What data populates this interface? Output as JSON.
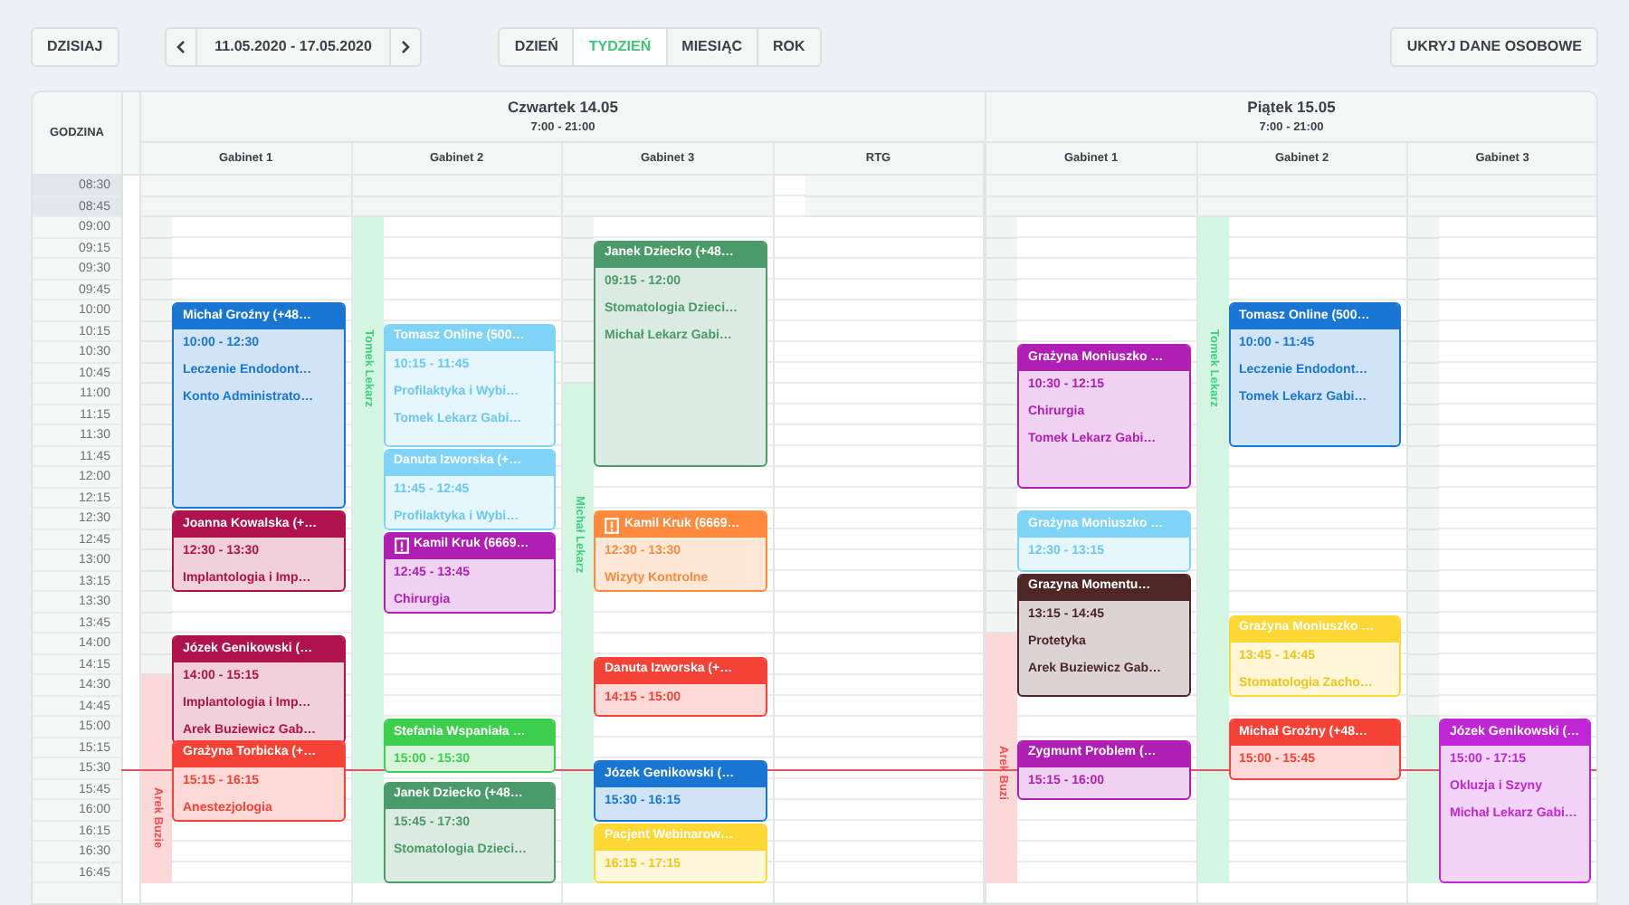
{
  "toolbar": {
    "today_button": "DZISIAJ",
    "date_range": "11.05.2020 - 17.05.2020",
    "views": [
      {
        "label": "DZIEŃ",
        "selected": false
      },
      {
        "label": "TYDZIEŃ",
        "selected": true
      },
      {
        "label": "MIESIĄC",
        "selected": false
      },
      {
        "label": "ROK",
        "selected": false
      }
    ],
    "hide_button": "UKRYJ DANE OSOBOWE"
  },
  "calendar": {
    "time_column_label": "GODZINA",
    "time_slots": [
      {
        "label": "08:30",
        "closed": true,
        "now": false
      },
      {
        "label": "08:45",
        "closed": true,
        "now": false
      },
      {
        "label": "09:00",
        "closed": false,
        "now": false
      },
      {
        "label": "09:15",
        "closed": false,
        "now": false
      },
      {
        "label": "09:30",
        "closed": false,
        "now": false
      },
      {
        "label": "09:45",
        "closed": false,
        "now": false
      },
      {
        "label": "10:00",
        "closed": false,
        "now": false
      },
      {
        "label": "10:15",
        "closed": false,
        "now": false
      },
      {
        "label": "10:30",
        "closed": false,
        "now": false
      },
      {
        "label": "10:45",
        "closed": false,
        "now": false
      },
      {
        "label": "11:00",
        "closed": false,
        "now": false
      },
      {
        "label": "11:15",
        "closed": false,
        "now": false
      },
      {
        "label": "11:30",
        "closed": false,
        "now": false
      },
      {
        "label": "11:45",
        "closed": false,
        "now": false
      },
      {
        "label": "12:00",
        "closed": false,
        "now": false
      },
      {
        "label": "12:15",
        "closed": false,
        "now": false
      },
      {
        "label": "12:30",
        "closed": false,
        "now": false
      },
      {
        "label": "12:45",
        "closed": false,
        "now": false
      },
      {
        "label": "13:00",
        "closed": false,
        "now": false
      },
      {
        "label": "13:15",
        "closed": false,
        "now": false
      },
      {
        "label": "13:30",
        "closed": false,
        "now": false
      },
      {
        "label": "13:45",
        "closed": false,
        "now": false
      },
      {
        "label": "14:00",
        "closed": false,
        "now": false
      },
      {
        "label": "14:15",
        "closed": false,
        "now": false
      },
      {
        "label": "14:30",
        "closed": false,
        "now": false
      },
      {
        "label": "14:45",
        "closed": false,
        "now": false
      },
      {
        "label": "15:00",
        "closed": false,
        "now": false
      },
      {
        "label": "15:15",
        "closed": false,
        "now": false
      },
      {
        "label": "15:30",
        "closed": false,
        "now": true
      },
      {
        "label": "15:45",
        "closed": false,
        "now": false
      },
      {
        "label": "16:00",
        "closed": false,
        "now": false
      },
      {
        "label": "16:15",
        "closed": false,
        "now": false
      },
      {
        "label": "16:30",
        "closed": false,
        "now": false
      },
      {
        "label": "16:45",
        "closed": false,
        "now": false
      }
    ],
    "days": [
      {
        "title": "Czwartek 14.05",
        "hours": "7:00 - 21:00",
        "rooms": [
          {
            "name": "Gabinet 1",
            "strip": {
              "doctor": "Arek Buzie",
              "color": "#fdd8d8",
              "on_shift": [
                false,
                false,
                false,
                false,
                false,
                false,
                false,
                false,
                false,
                false,
                false,
                false,
                false,
                false,
                false,
                false,
                false,
                false,
                false,
                false,
                false,
                false,
                false,
                false,
                true,
                true,
                true,
                true,
                true,
                true,
                true,
                true,
                true,
                true
              ]
            },
            "events": [
              {
                "patient": "Michał Groźny (+48…",
                "time": "10:00 - 12:30",
                "lines": [
                  "Leczenie Endodont…",
                  "Konto Administrato…"
                ],
                "color": "#1976d2",
                "alert": false
              },
              {
                "patient": "Joanna Kowalska (+…",
                "time": "12:30 - 13:30",
                "lines": [
                  "Implantologia i Imp…"
                ],
                "color": "#b0124a",
                "alert": false
              },
              {
                "patient": "Józek Genikowski (…",
                "time": "14:00 - 15:15",
                "lines": [
                  "Implantologia i Imp…",
                  "Arek Buziewicz Gab…"
                ],
                "color": "#b0124a",
                "alert": false
              },
              {
                "patient": "Grażyna Torbicka (+…",
                "time": "15:15 - 16:15",
                "lines": [
                  "Anestezjologia"
                ],
                "color": "#f44336",
                "alert": false
              }
            ]
          },
          {
            "name": "Gabinet 2",
            "strip": {
              "doctor": "Tomek Lekarz",
              "color": "#d5f5e3",
              "on_shift": [
                false,
                false,
                true,
                true,
                true,
                true,
                true,
                true,
                true,
                true,
                true,
                true,
                true,
                true,
                true,
                true,
                true,
                true,
                true,
                true,
                true,
                true,
                true,
                true,
                true,
                true,
                true,
                true,
                true,
                true,
                true,
                true,
                true,
                true
              ]
            },
            "events": [
              {
                "patient": "Tomasz Online (500…",
                "time": "10:15 - 11:45",
                "lines": [
                  "Profilaktyka i Wybi…",
                  "Tomek Lekarz Gabi…"
                ],
                "color": "#7fd3f7",
                "alert": false
              },
              {
                "patient": "Danuta Izworska (+…",
                "time": "11:45 - 12:45",
                "lines": [
                  "Profilaktyka i Wybi…"
                ],
                "color": "#7fd3f7",
                "alert": false
              },
              {
                "patient": "Kamil Kruk (6669…",
                "time": "12:45 - 13:45",
                "lines": [
                  "Chirurgia"
                ],
                "color": "#b01fb3",
                "alert": true
              },
              {
                "patient": "Stefania Wspaniała …",
                "time": "15:00 - 15:30",
                "color": "#3ccf4e",
                "alert": false
              },
              {
                "patient": "Janek Dziecko (+48…",
                "time": "15:45 - 17:30",
                "lines": [
                  "Stomatologia Dzieci…"
                ],
                "color": "#4a9a6a",
                "alert": false
              }
            ]
          },
          {
            "name": "Gabinet 3",
            "strip": {
              "doctor": "Michał Lekarz",
              "color": "#d5f5e3",
              "on_shift": [
                false,
                false,
                false,
                false,
                false,
                false,
                false,
                false,
                false,
                false,
                true,
                true,
                true,
                true,
                true,
                true,
                true,
                true,
                true,
                true,
                true,
                true,
                true,
                true,
                true,
                true,
                true,
                true,
                true,
                true,
                true,
                true,
                true,
                true
              ]
            },
            "events": [
              {
                "patient": "Janek Dziecko (+48…",
                "time": "09:15 - 12:00",
                "lines": [
                  "Stomatologia Dzieci…",
                  "Michał Lekarz Gabi…"
                ],
                "color": "#4a9a6a",
                "alert": false
              },
              {
                "patient": "Kamil Kruk (6669…",
                "time": "12:30 - 13:30",
                "lines": [
                  "Wizyty Kontrolne"
                ],
                "color": "#ff8a3d",
                "alert": true
              },
              {
                "patient": "Danuta Izworska (+…",
                "time": "14:15 - 15:00",
                "color": "#f44336",
                "alert": false
              },
              {
                "patient": "Józek Genikowski (…",
                "time": "15:30 - 16:15",
                "color": "#1976d2",
                "alert": false
              },
              {
                "patient": "Pacjent Webinarow…",
                "time": "16:15 - 17:15",
                "color": "#fdd835",
                "alert": false
              }
            ]
          },
          {
            "name": "RTG"
          }
        ]
      },
      {
        "title": "Piątek 15.05",
        "hours": "7:00 - 21:00",
        "rooms": [
          {
            "name": "Gabinet 1",
            "strip": {
              "doctor": "Arek Buzi",
              "color": "#fdd8d8",
              "on_shift": [
                false,
                false,
                false,
                false,
                false,
                false,
                false,
                false,
                false,
                false,
                false,
                false,
                false,
                false,
                false,
                false,
                false,
                false,
                false,
                false,
                false,
                false,
                true,
                true,
                true,
                true,
                true,
                true,
                true,
                true,
                true,
                true,
                true,
                true
              ]
            },
            "events": [
              {
                "patient": "Grażyna Moniuszko …",
                "time": "10:30 - 12:15",
                "lines": [
                  "Chirurgia",
                  "Tomek Lekarz Gabi…"
                ],
                "color": "#b01fb3",
                "alert": false
              },
              {
                "patient": "Grażyna Moniuszko …",
                "time": "12:30 - 13:15",
                "color": "#7fd3f7",
                "alert": false
              },
              {
                "patient": "Grazyna Momentu…",
                "time": "13:15 - 14:45",
                "lines": [
                  "Protetyka",
                  "Arek Buziewicz Gab…"
                ],
                "color": "#4e2626",
                "alert": false
              },
              {
                "patient": "Zygmunt Problem (…",
                "time": "15:15 - 16:00",
                "color": "#b01fb3",
                "alert": false
              }
            ]
          },
          {
            "name": "Gabinet 2",
            "strip": {
              "doctor": "Tomek Lekarz",
              "color": "#d5f5e3",
              "on_shift": [
                false,
                false,
                true,
                true,
                true,
                true,
                true,
                true,
                true,
                true,
                true,
                true,
                true,
                true,
                true,
                true,
                true,
                true,
                true,
                true,
                true,
                true,
                true,
                true,
                true,
                true,
                true,
                true,
                true,
                true,
                true,
                true,
                true,
                true
              ]
            },
            "events": [
              {
                "patient": "Tomasz Online (500…",
                "time": "10:00 - 11:45",
                "lines": [
                  "Leczenie Endodont…",
                  "Tomek Lekarz Gabi…"
                ],
                "color": "#1976d2",
                "alert": false
              },
              {
                "patient": "Grażyna Moniuszko …",
                "time": "13:45 - 14:45",
                "lines": [
                  "Stomatologia Zacho…"
                ],
                "color": "#fdd835",
                "alert": false
              },
              {
                "patient": "Michał Groźny (+48…",
                "time": "15:00 - 15:45",
                "color": "#f44336",
                "alert": false
              }
            ]
          },
          {
            "name": "Gabinet 3",
            "strip": {
              "color": "#d5f5e3",
              "on_shift": [
                false,
                false,
                false,
                false,
                false,
                false,
                false,
                false,
                false,
                false,
                false,
                false,
                false,
                false,
                false,
                false,
                false,
                false,
                false,
                false,
                false,
                false,
                false,
                false,
                false,
                false,
                true,
                true,
                true,
                true,
                true,
                true,
                true,
                true
              ]
            },
            "events": [
              {
                "patient": "Józek Genikowski (…",
                "time": "15:00 - 17:15",
                "lines": [
                  "Okluzja i Szyny",
                  "Michał Lekarz Gabi…"
                ],
                "color": "#c026d3",
                "alert": false
              }
            ]
          }
        ]
      }
    ]
  }
}
